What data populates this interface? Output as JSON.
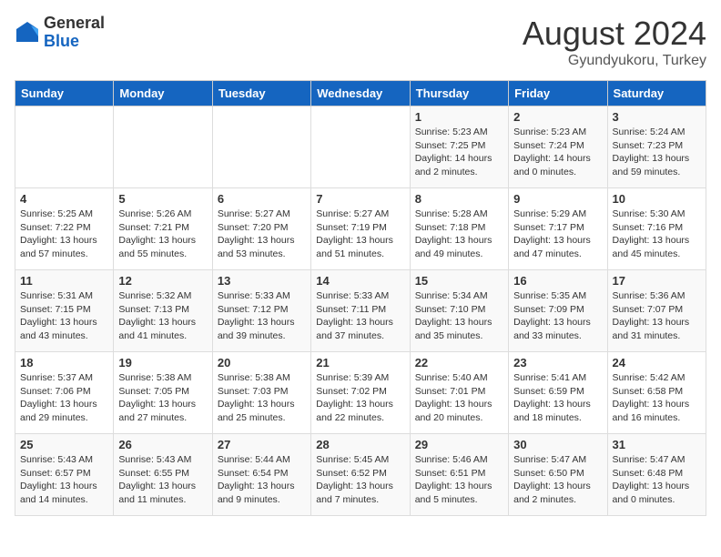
{
  "header": {
    "logo_general": "General",
    "logo_blue": "Blue",
    "month_title": "August 2024",
    "location": "Gyundyukoru, Turkey"
  },
  "weekdays": [
    "Sunday",
    "Monday",
    "Tuesday",
    "Wednesday",
    "Thursday",
    "Friday",
    "Saturday"
  ],
  "weeks": [
    [
      {
        "day": "",
        "info": ""
      },
      {
        "day": "",
        "info": ""
      },
      {
        "day": "",
        "info": ""
      },
      {
        "day": "",
        "info": ""
      },
      {
        "day": "1",
        "info": "Sunrise: 5:23 AM\nSunset: 7:25 PM\nDaylight: 14 hours\nand 2 minutes."
      },
      {
        "day": "2",
        "info": "Sunrise: 5:23 AM\nSunset: 7:24 PM\nDaylight: 14 hours\nand 0 minutes."
      },
      {
        "day": "3",
        "info": "Sunrise: 5:24 AM\nSunset: 7:23 PM\nDaylight: 13 hours\nand 59 minutes."
      }
    ],
    [
      {
        "day": "4",
        "info": "Sunrise: 5:25 AM\nSunset: 7:22 PM\nDaylight: 13 hours\nand 57 minutes."
      },
      {
        "day": "5",
        "info": "Sunrise: 5:26 AM\nSunset: 7:21 PM\nDaylight: 13 hours\nand 55 minutes."
      },
      {
        "day": "6",
        "info": "Sunrise: 5:27 AM\nSunset: 7:20 PM\nDaylight: 13 hours\nand 53 minutes."
      },
      {
        "day": "7",
        "info": "Sunrise: 5:27 AM\nSunset: 7:19 PM\nDaylight: 13 hours\nand 51 minutes."
      },
      {
        "day": "8",
        "info": "Sunrise: 5:28 AM\nSunset: 7:18 PM\nDaylight: 13 hours\nand 49 minutes."
      },
      {
        "day": "9",
        "info": "Sunrise: 5:29 AM\nSunset: 7:17 PM\nDaylight: 13 hours\nand 47 minutes."
      },
      {
        "day": "10",
        "info": "Sunrise: 5:30 AM\nSunset: 7:16 PM\nDaylight: 13 hours\nand 45 minutes."
      }
    ],
    [
      {
        "day": "11",
        "info": "Sunrise: 5:31 AM\nSunset: 7:15 PM\nDaylight: 13 hours\nand 43 minutes."
      },
      {
        "day": "12",
        "info": "Sunrise: 5:32 AM\nSunset: 7:13 PM\nDaylight: 13 hours\nand 41 minutes."
      },
      {
        "day": "13",
        "info": "Sunrise: 5:33 AM\nSunset: 7:12 PM\nDaylight: 13 hours\nand 39 minutes."
      },
      {
        "day": "14",
        "info": "Sunrise: 5:33 AM\nSunset: 7:11 PM\nDaylight: 13 hours\nand 37 minutes."
      },
      {
        "day": "15",
        "info": "Sunrise: 5:34 AM\nSunset: 7:10 PM\nDaylight: 13 hours\nand 35 minutes."
      },
      {
        "day": "16",
        "info": "Sunrise: 5:35 AM\nSunset: 7:09 PM\nDaylight: 13 hours\nand 33 minutes."
      },
      {
        "day": "17",
        "info": "Sunrise: 5:36 AM\nSunset: 7:07 PM\nDaylight: 13 hours\nand 31 minutes."
      }
    ],
    [
      {
        "day": "18",
        "info": "Sunrise: 5:37 AM\nSunset: 7:06 PM\nDaylight: 13 hours\nand 29 minutes."
      },
      {
        "day": "19",
        "info": "Sunrise: 5:38 AM\nSunset: 7:05 PM\nDaylight: 13 hours\nand 27 minutes."
      },
      {
        "day": "20",
        "info": "Sunrise: 5:38 AM\nSunset: 7:03 PM\nDaylight: 13 hours\nand 25 minutes."
      },
      {
        "day": "21",
        "info": "Sunrise: 5:39 AM\nSunset: 7:02 PM\nDaylight: 13 hours\nand 22 minutes."
      },
      {
        "day": "22",
        "info": "Sunrise: 5:40 AM\nSunset: 7:01 PM\nDaylight: 13 hours\nand 20 minutes."
      },
      {
        "day": "23",
        "info": "Sunrise: 5:41 AM\nSunset: 6:59 PM\nDaylight: 13 hours\nand 18 minutes."
      },
      {
        "day": "24",
        "info": "Sunrise: 5:42 AM\nSunset: 6:58 PM\nDaylight: 13 hours\nand 16 minutes."
      }
    ],
    [
      {
        "day": "25",
        "info": "Sunrise: 5:43 AM\nSunset: 6:57 PM\nDaylight: 13 hours\nand 14 minutes."
      },
      {
        "day": "26",
        "info": "Sunrise: 5:43 AM\nSunset: 6:55 PM\nDaylight: 13 hours\nand 11 minutes."
      },
      {
        "day": "27",
        "info": "Sunrise: 5:44 AM\nSunset: 6:54 PM\nDaylight: 13 hours\nand 9 minutes."
      },
      {
        "day": "28",
        "info": "Sunrise: 5:45 AM\nSunset: 6:52 PM\nDaylight: 13 hours\nand 7 minutes."
      },
      {
        "day": "29",
        "info": "Sunrise: 5:46 AM\nSunset: 6:51 PM\nDaylight: 13 hours\nand 5 minutes."
      },
      {
        "day": "30",
        "info": "Sunrise: 5:47 AM\nSunset: 6:50 PM\nDaylight: 13 hours\nand 2 minutes."
      },
      {
        "day": "31",
        "info": "Sunrise: 5:47 AM\nSunset: 6:48 PM\nDaylight: 13 hours\nand 0 minutes."
      }
    ]
  ]
}
